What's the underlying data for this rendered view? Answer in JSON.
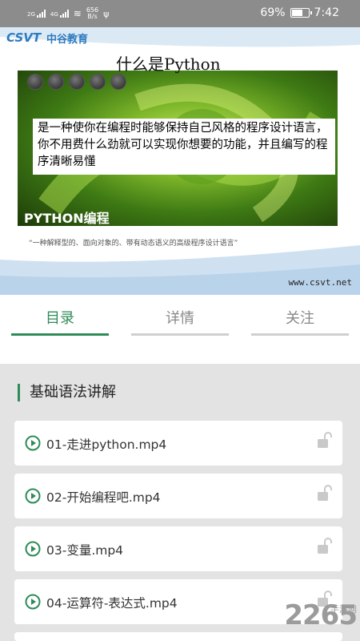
{
  "status_bar": {
    "signal_1": "2G",
    "signal_2": "4G",
    "net_speed": "656",
    "net_unit": "B/s",
    "battery_percent": "69%",
    "battery_level": 0.69,
    "time": "7:42"
  },
  "banner": {
    "logo": "CSVT",
    "logo_cn": "中谷教育",
    "title": "什么是Python",
    "description": "是一种使你在编程时能够保持自己风格的程序设计语言，你不用费什么劲就可以实现你想要的功能，并且编写的程序清晰易懂",
    "photo_label": "PYTHON编程",
    "caption": "“一种解释型的、面向对象的、带有动态语义的高级程序设计语言”",
    "site": "www.csvt.net"
  },
  "tabs": [
    {
      "label": "目录",
      "active": true
    },
    {
      "label": "详情",
      "active": false
    },
    {
      "label": "关注",
      "active": false
    }
  ],
  "section": {
    "title": "基础语法讲解"
  },
  "lessons": [
    {
      "label": "01-走进python.mp4"
    },
    {
      "label": "02-开始编程吧.mp4"
    },
    {
      "label": "03-变量.mp4"
    },
    {
      "label": "04-运算符-表达式.mp4"
    }
  ],
  "watermark": {
    "number": "2265",
    "cn": "手游网"
  },
  "colors": {
    "accent": "#2e8b57",
    "status_bar": "#8c8c8c",
    "list_bg": "#e3e3e3",
    "logo_blue": "#2d7bbf"
  }
}
